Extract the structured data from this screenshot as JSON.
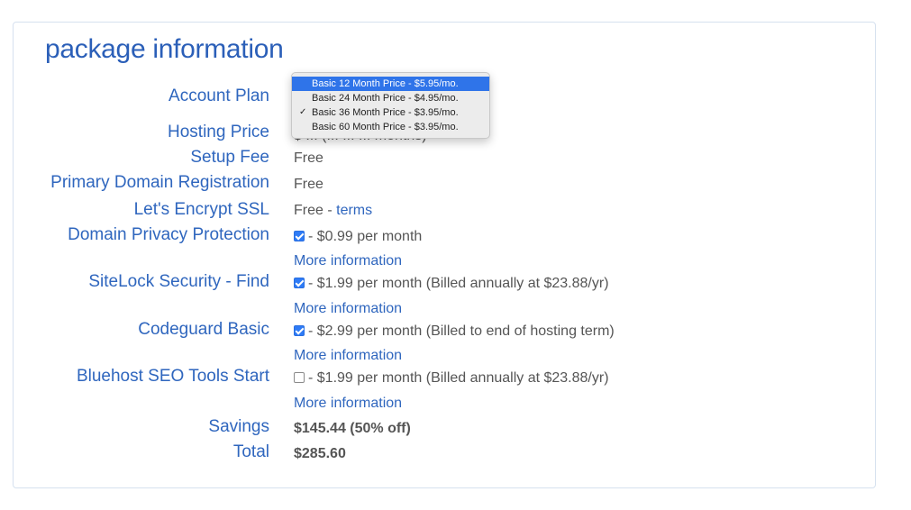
{
  "section": {
    "title": "package information"
  },
  "rows": {
    "account_plan": {
      "label": "Account Plan"
    },
    "hosting_price": {
      "label": "Hosting Price",
      "value": "$ ... (... ... ... months)"
    },
    "setup_fee": {
      "label": "Setup Fee",
      "value": "Free"
    },
    "primary_domain": {
      "label": "Primary Domain Registration",
      "value": "Free"
    },
    "ssl": {
      "label": "Let's Encrypt SSL",
      "value": "Free - ",
      "link": "terms"
    },
    "privacy": {
      "label": "Domain Privacy Protection",
      "checked": true,
      "price": "- $0.99 per month",
      "more": "More information"
    },
    "sitelock": {
      "label": "SiteLock Security - Find",
      "checked": true,
      "price": "- $1.99 per month (Billed annually at $23.88/yr)",
      "more": "More information"
    },
    "codeguard": {
      "label": "Codeguard Basic",
      "checked": true,
      "price": "- $2.99 per month (Billed to end of hosting term)",
      "more": "More information"
    },
    "seo": {
      "label": "Bluehost SEO Tools Start",
      "checked": false,
      "price": "- $1.99 per month (Billed annually at $23.88/yr)",
      "more": "More information"
    },
    "savings": {
      "label": "Savings",
      "value": "$145.44 (50% off)"
    },
    "total": {
      "label": "Total",
      "value": "$285.60"
    }
  },
  "account_plan_dropdown": {
    "options": [
      {
        "label": "Basic 12 Month Price - $5.95/mo.",
        "highlighted": true,
        "selected": false
      },
      {
        "label": "Basic 24 Month Price - $4.95/mo.",
        "highlighted": false,
        "selected": false
      },
      {
        "label": "Basic 36 Month Price - $3.95/mo.",
        "highlighted": false,
        "selected": true
      },
      {
        "label": "Basic 60 Month Price - $3.95/mo.",
        "highlighted": false,
        "selected": false
      }
    ],
    "check_icon": "checkmark-icon"
  },
  "colors": {
    "label_blue": "#2f66be",
    "highlight": "#2f74e9",
    "checkbox_blue": "#2e7bf6"
  }
}
